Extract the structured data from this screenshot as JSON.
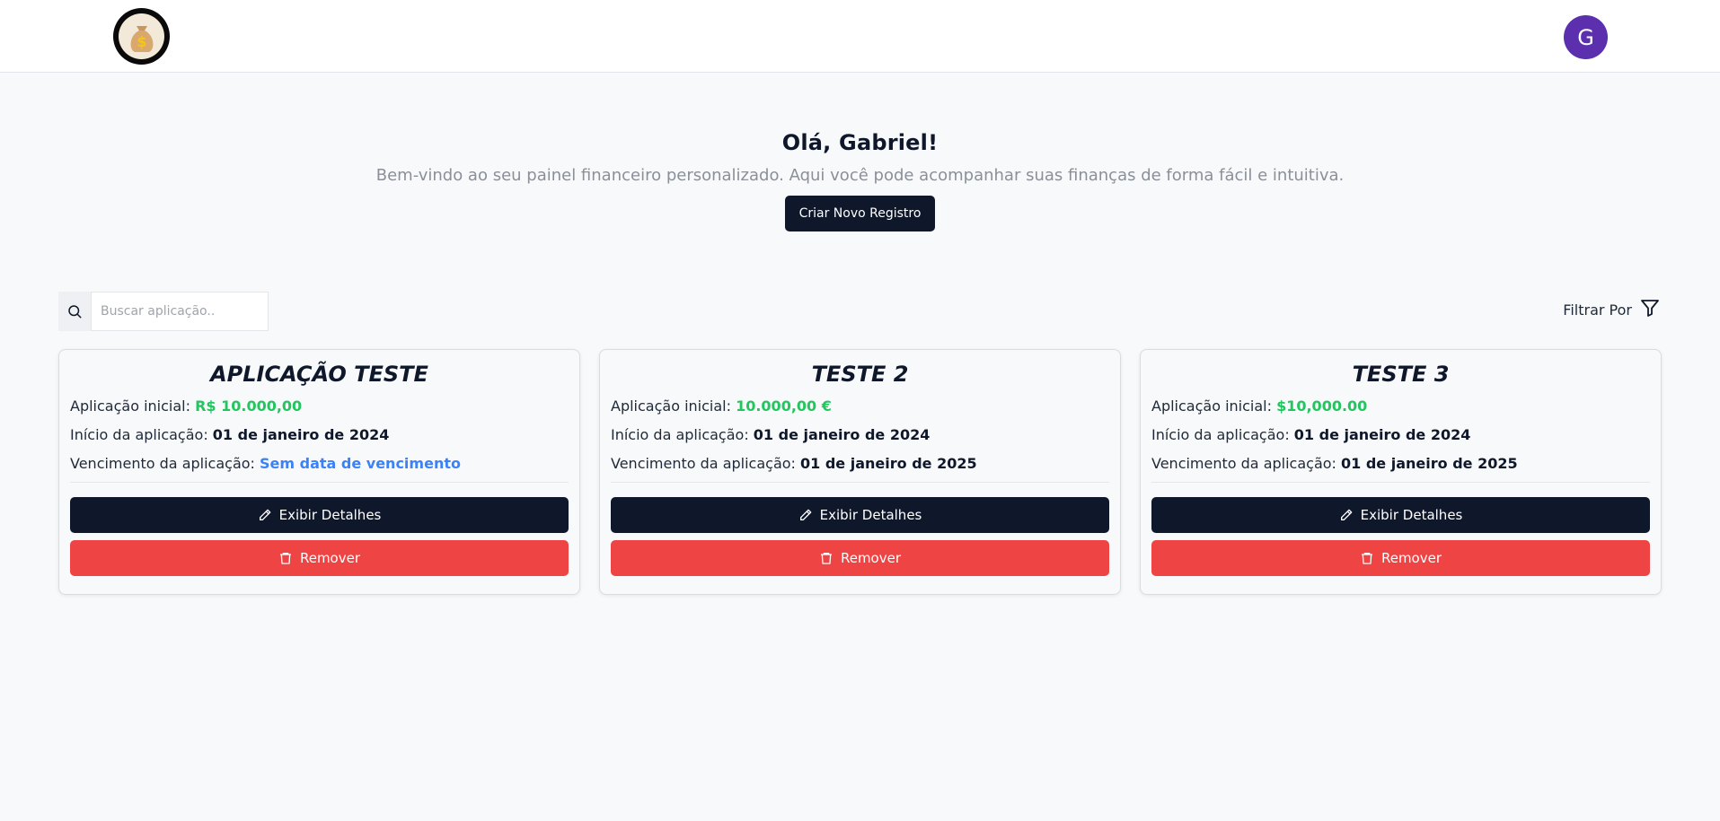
{
  "header": {
    "logo_icon": "money-bag-icon",
    "avatar_initial": "G"
  },
  "hero": {
    "greeting": "Olá, Gabriel!",
    "subtitle": "Bem-vindo ao seu painel financeiro personalizado. Aqui você pode acompanhar suas finanças de forma fácil e intuitiva.",
    "create_button": "Criar Novo Registro"
  },
  "toolbar": {
    "search_placeholder": "Buscar aplicação..",
    "filter_label": "Filtrar Por"
  },
  "labels": {
    "initial": "Aplicação inicial: ",
    "start": "Início da aplicação: ",
    "maturity": "Vencimento da aplicação: ",
    "details_button": "Exibir Detalhes",
    "remove_button": "Remover"
  },
  "cards": [
    {
      "title": "APLICAÇÃO TESTE",
      "initial": "R$ 10.000,00",
      "start": "01 de janeiro de 2024",
      "maturity": "Sem data de vencimento"
    },
    {
      "title": "TESTE 2",
      "initial": "10.000,00 €",
      "start": "01 de janeiro de 2024",
      "maturity": "01 de janeiro de 2025"
    },
    {
      "title": "TESTE 3",
      "initial": "$10,000.00",
      "start": "01 de janeiro de 2024",
      "maturity": "01 de janeiro de 2025"
    }
  ],
  "colors": {
    "primary": "#0f172a",
    "danger": "#ef4444",
    "money": "#22c55e",
    "no_date": "#3b82f6",
    "avatar": "#5b2fae"
  }
}
